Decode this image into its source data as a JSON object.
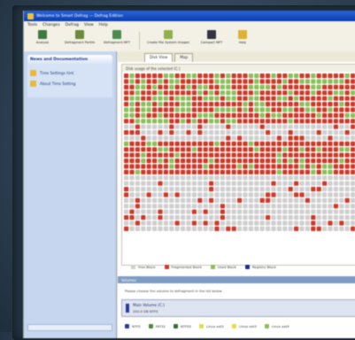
{
  "window": {
    "title": "Welcome to Smart Defrag — Defrag Edition",
    "menu": [
      "Tools",
      "Changes",
      "Defrag",
      "View",
      "Help"
    ]
  },
  "toolbar": {
    "buttons": [
      {
        "label": "Analyze",
        "icon": "analyze-icon",
        "color": "#3d7a3d"
      },
      {
        "label": "Defragment Partition",
        "icon": "defrag-partition-icon",
        "color": "#6a8c3a"
      },
      {
        "label": "Defragment MFT",
        "icon": "defrag-mft-icon",
        "color": "#4e8a4e"
      },
      {
        "label": "Create File System Images",
        "icon": "filesystem-image-icon",
        "color": "#8fb04a"
      },
      {
        "label": "Compact MFT",
        "icon": "compact-mft-icon",
        "color": "#333344"
      },
      {
        "label": "Help",
        "icon": "help-icon",
        "color": "#e0b030"
      }
    ]
  },
  "sidebar": {
    "header": "News and Documentation",
    "links": [
      {
        "label": "Time Settings hint",
        "icon": "document-icon"
      },
      {
        "label": "About Time Setting",
        "icon": "document-icon"
      }
    ]
  },
  "tabs": [
    {
      "label": "Disk View",
      "active": true
    },
    {
      "label": "Map",
      "active": false
    }
  ],
  "disk_view": {
    "header": "Disk usage of the selected (C:)"
  },
  "legend_blocks": [
    {
      "label": "Free Block",
      "color": "#cfcfcf"
    },
    {
      "label": "Fragmented Block",
      "color": "#cc3a2a"
    },
    {
      "label": "Used Block",
      "color": "#8cbf5a"
    },
    {
      "label": "Registry Block",
      "color": "#1d2b8f"
    }
  ],
  "volumes_section": {
    "title": "Volumes",
    "status": "Please choose the volume to defragment in the list below",
    "volume_name": "Main Volume (C:)",
    "volume_size": "200.0 GB NTFS"
  },
  "legend_fs": [
    {
      "label": "NTFS",
      "color": "#2a3a9a"
    },
    {
      "label": "FAT32",
      "color": "#4a8a3a"
    },
    {
      "label": "NTFS5",
      "color": "#3a6a3a"
    },
    {
      "label": "Linux ext2",
      "color": "#e8d84a"
    },
    {
      "label": "Linux ext3",
      "color": "#e8d84a"
    },
    {
      "label": "Linux ext4",
      "color": "#8cbf5a"
    }
  ],
  "colors": {
    "fragmented": "#cc3a2a",
    "used": "#8cbf5a",
    "free": "#cfcfcf",
    "titlebar": "#1a4fc4"
  }
}
